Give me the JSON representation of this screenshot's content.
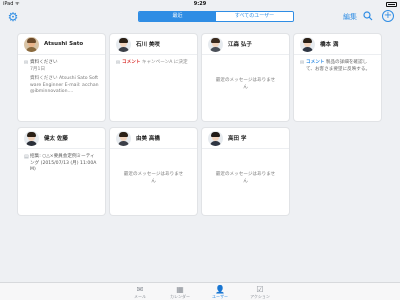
{
  "status_bar": {
    "carrier": "iPad ᯤ",
    "time": "9:29"
  },
  "nav": {
    "settings_icon": "gear-icon",
    "segments": [
      "最近",
      "すべてのユーザー"
    ],
    "edit_label": "編集",
    "search_icon": "search-icon",
    "add_icon": "plus-icon",
    "plus_glyph": "+",
    "settings_glyph": "⚙"
  },
  "cards": [
    {
      "name": "Atsushi Sato",
      "type": "mail",
      "subject": "資料ください",
      "date": "7月1日",
      "body": "資料ください Atsushi Sato Software Enginner E-mail: acchan@ibminnovation...."
    },
    {
      "name": "石川 美咲",
      "type": "comment",
      "badge": "コメント",
      "text": "キャンペーンA に決定"
    },
    {
      "name": "江森 弘子",
      "type": "empty",
      "text": "最近のメッセージはありません"
    },
    {
      "name": "橋本 満",
      "type": "comment",
      "badge": "コメント",
      "text": "製品の詳細を確認して、お客さま要望に反映する。"
    },
    {
      "name": "健太 佐藤",
      "type": "event",
      "text": "招集: ○△×要員会定例ミーティング (2015/07/13 (月) 11:00AM)"
    },
    {
      "name": "由美 高橋",
      "type": "empty",
      "text": "最近のメッセージはありません"
    },
    {
      "name": "高田 学",
      "type": "empty",
      "text": "最近のメッセージはありません"
    }
  ],
  "tabbar": [
    {
      "label": "メール",
      "icon": "mail-icon",
      "glyph": "✉"
    },
    {
      "label": "カレンダー",
      "icon": "calendar-icon",
      "glyph": "▦"
    },
    {
      "label": "ユーザー",
      "icon": "user-icon",
      "glyph": "👤"
    },
    {
      "label": "アクション",
      "icon": "action-icon",
      "glyph": "☑"
    }
  ],
  "active_tab": 2,
  "colors": {
    "accent": "#2f8de4",
    "comment_red": "#d9302d",
    "background": "#eef0f3"
  }
}
